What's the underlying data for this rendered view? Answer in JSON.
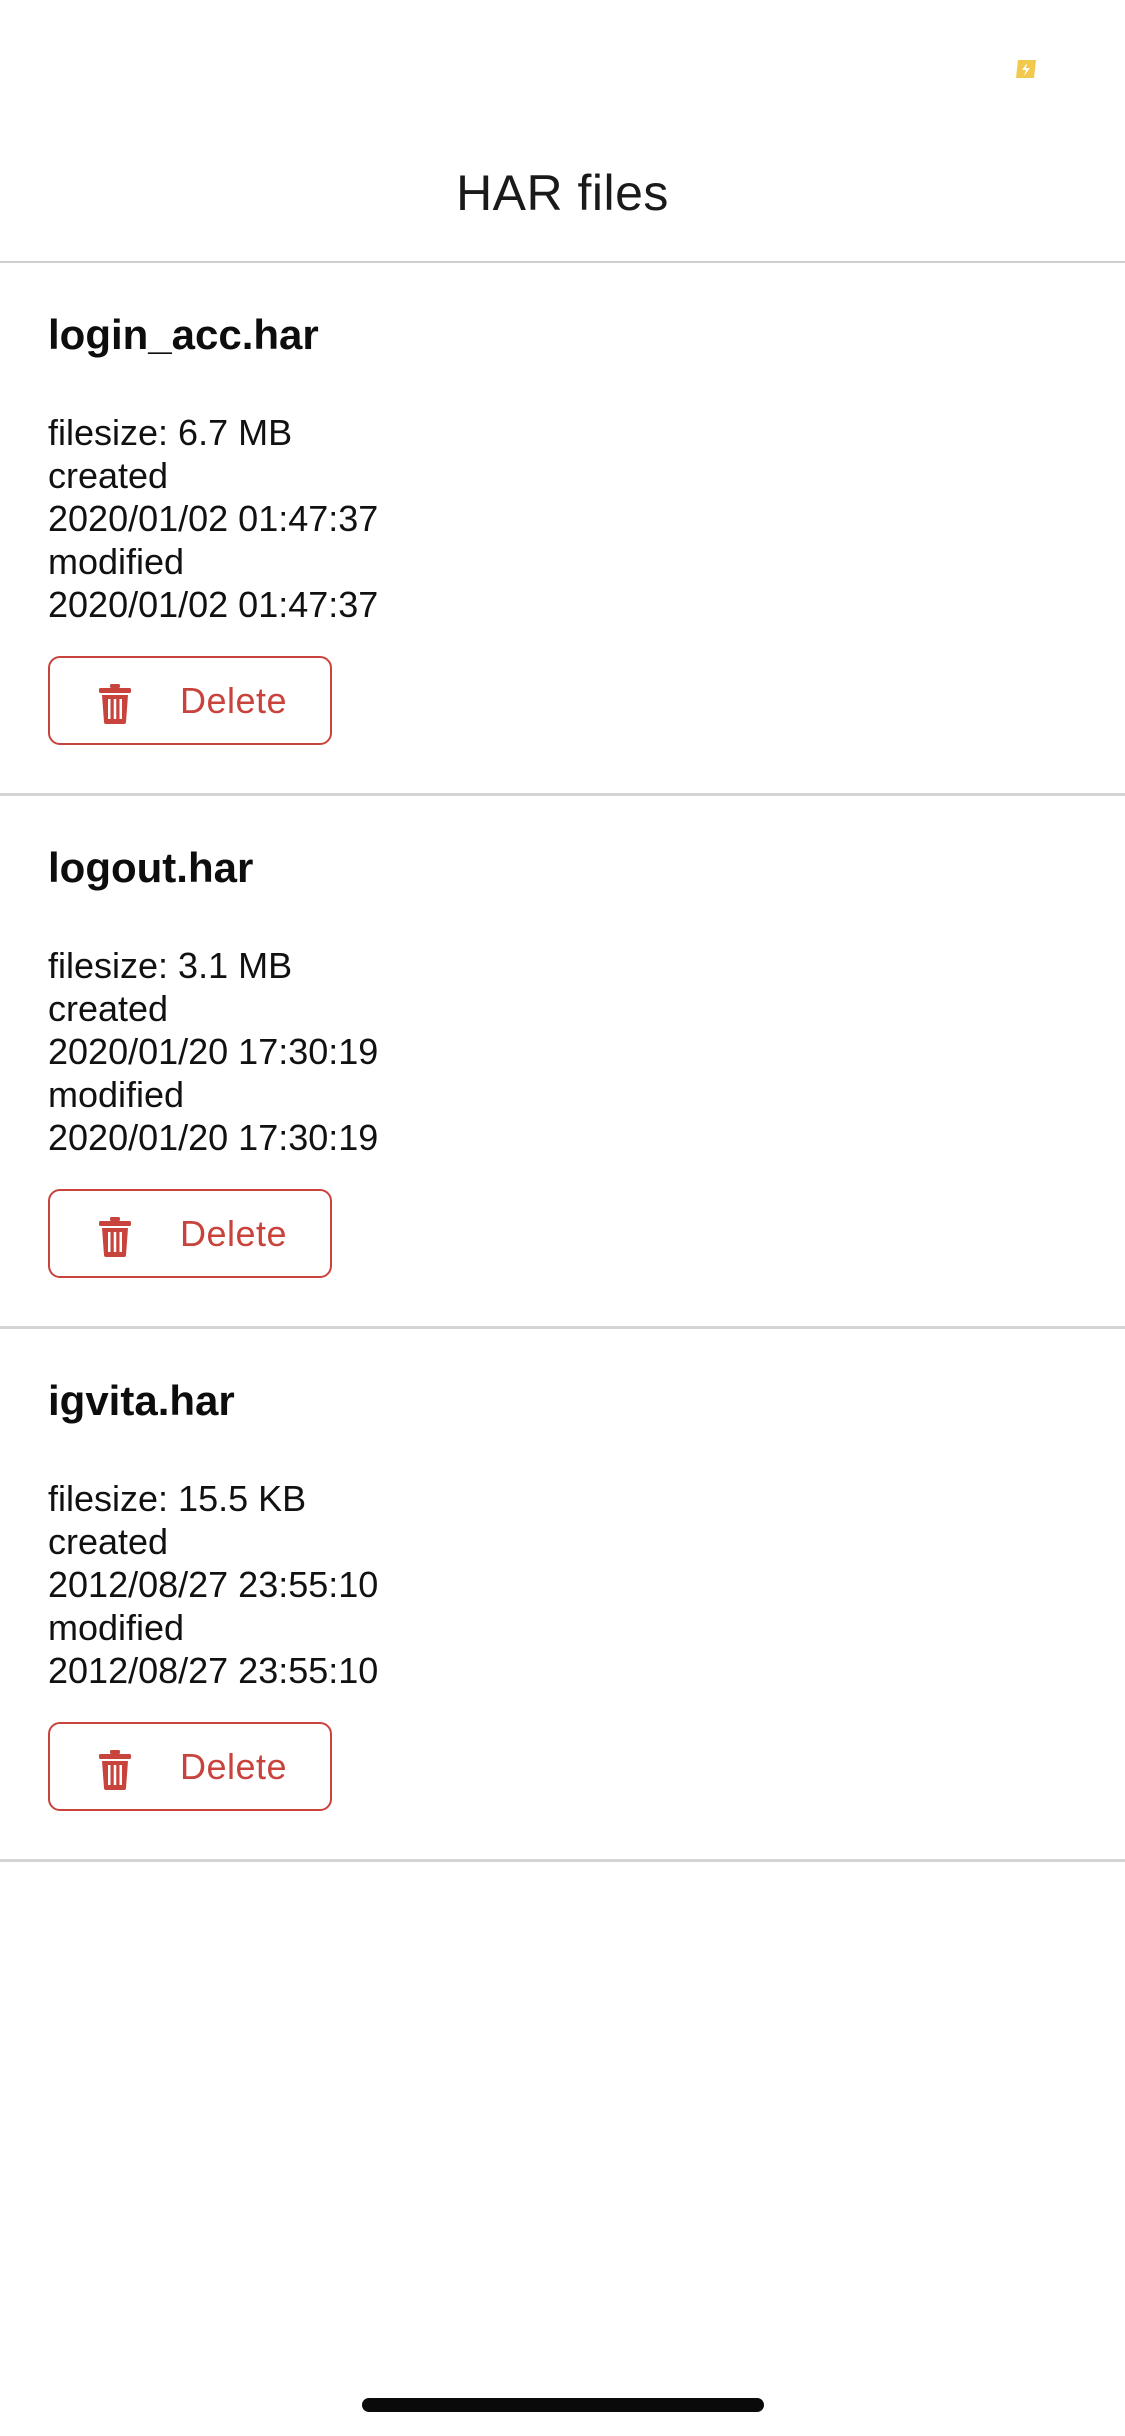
{
  "header": {
    "title": "HAR files"
  },
  "status_bar": {
    "battery_icon": "battery-charging-icon",
    "battery_color": "#F2C94C"
  },
  "files": [
    {
      "name": "login_acc.har",
      "filesize": "filesize: 6.7 MB",
      "created_label": "created",
      "created": "2020/01/02 01:47:37",
      "modified_label": "modified",
      "modified": "2020/01/02 01:47:37",
      "delete_label": "Delete"
    },
    {
      "name": "logout.har",
      "filesize": "filesize: 3.1 MB",
      "created_label": "created",
      "created": "2020/01/20 17:30:19",
      "modified_label": "modified",
      "modified": "2020/01/20 17:30:19",
      "delete_label": "Delete"
    },
    {
      "name": "igvita.har",
      "filesize": "filesize: 15.5 KB",
      "created_label": "created",
      "created": "2012/08/27 23:55:10",
      "modified_label": "modified",
      "modified": "2012/08/27 23:55:10",
      "delete_label": "Delete"
    }
  ],
  "colors": {
    "accent": "#C9433D",
    "divider": "#D4D4D4"
  },
  "icons": {
    "delete": "trash-icon"
  }
}
